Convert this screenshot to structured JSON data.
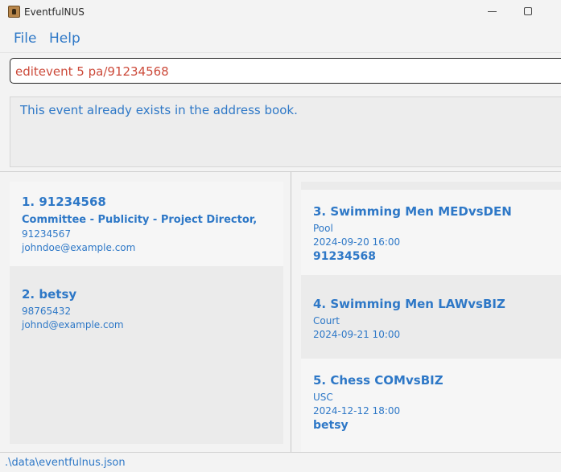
{
  "window": {
    "title": "EventfulNUS"
  },
  "menu": {
    "file": "File",
    "help": "Help"
  },
  "command": {
    "value": "editevent 5 pa/91234568"
  },
  "result": {
    "message": "This event already exists in the address book."
  },
  "persons": [
    {
      "index_name": "1. 91234568",
      "roles": "Committee - Publicity - Project Director,",
      "phone": "91234567",
      "email": "johndoe@example.com"
    },
    {
      "index_name": "2. betsy",
      "phone": "98765432",
      "email": "johnd@example.com"
    }
  ],
  "events": [
    {
      "title": "3. Swimming Men MEDvsDEN",
      "venue": "Pool",
      "datetime": "2024-09-20 16:00",
      "participant": "91234568"
    },
    {
      "title": "4. Swimming Men LAWvsBIZ",
      "venue": "Court",
      "datetime": "2024-09-21 10:00"
    },
    {
      "title": "5. Chess COMvsBIZ",
      "venue": "USC",
      "datetime": "2024-12-12 18:00",
      "participant": "betsy"
    }
  ],
  "status": {
    "path": ".\\data\\eventfulnus.json"
  },
  "colors": {
    "accent": "#2e78c7",
    "command_text": "#cc4a3a"
  }
}
